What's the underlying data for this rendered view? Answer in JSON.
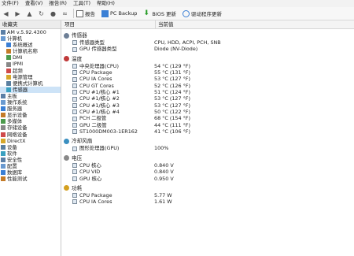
{
  "menu": [
    "文件(F)",
    "查看(V)",
    "报告(R)",
    "工具(T)",
    "帮助(H)"
  ],
  "toolbar": {
    "report_label": "报告",
    "pcbackup_label": "PC Backup",
    "bios_label": "BIOS 更新",
    "driver_label": "驱动程序更新"
  },
  "sidebar": {
    "header": "收藏夹",
    "items": [
      {
        "label": "AM v.5.92.4300",
        "indent": 0
      },
      {
        "label": "计算机",
        "indent": 0
      },
      {
        "label": "系统概述",
        "indent": 1
      },
      {
        "label": "计算机名称",
        "indent": 1
      },
      {
        "label": "DMI",
        "indent": 1
      },
      {
        "label": "IPMI",
        "indent": 1
      },
      {
        "label": "超频",
        "indent": 1
      },
      {
        "label": "电源管理",
        "indent": 1
      },
      {
        "label": "便携式计算机",
        "indent": 1
      },
      {
        "label": "传感器",
        "indent": 1,
        "selected": true
      },
      {
        "label": "主板",
        "indent": 0
      },
      {
        "label": "操作系统",
        "indent": 0
      },
      {
        "label": "服务器",
        "indent": 0
      },
      {
        "label": "显示设备",
        "indent": 0
      },
      {
        "label": "多媒体",
        "indent": 0
      },
      {
        "label": "存储设备",
        "indent": 0
      },
      {
        "label": "网络设备",
        "indent": 0
      },
      {
        "label": "DirectX",
        "indent": 0
      },
      {
        "label": "设备",
        "indent": 0
      },
      {
        "label": "软件",
        "indent": 0
      },
      {
        "label": "安全性",
        "indent": 0
      },
      {
        "label": "配置",
        "indent": 0
      },
      {
        "label": "数据库",
        "indent": 0
      },
      {
        "label": "性能测试",
        "indent": 0
      }
    ]
  },
  "columns": {
    "item": "项目",
    "value": "当前值"
  },
  "sections": [
    {
      "title": "传感器",
      "icon": "sensor-icon",
      "rows": [
        {
          "label": "传感器类型",
          "value": "CPU, HDD, ACPI, PCH, SNB"
        },
        {
          "label": "GPU 传感器类型",
          "value": "Diode (NV-Diode)"
        }
      ]
    },
    {
      "title": "温度",
      "icon": "temperature-icon",
      "rows": [
        {
          "label": "中央处理器(CPU)",
          "value": "54 °C  (129 °F)"
        },
        {
          "label": "CPU Package",
          "value": "55 °C  (131 °F)"
        },
        {
          "label": "CPU IA Cores",
          "value": "53 °C  (127 °F)"
        },
        {
          "label": "CPU GT Cores",
          "value": "52 °C  (126 °F)"
        },
        {
          "label": "CPU #1/核心 #1",
          "value": "51 °C  (124 °F)"
        },
        {
          "label": "CPU #1/核心 #2",
          "value": "53 °C  (127 °F)"
        },
        {
          "label": "CPU #1/核心 #3",
          "value": "53 °C  (127 °F)"
        },
        {
          "label": "CPU #1/核心 #4",
          "value": "50 °C  (122 °F)"
        },
        {
          "label": "PCH 二极管",
          "value": "68 °C  (154 °F)"
        },
        {
          "label": "GPU 二极管",
          "value": "44 °C  (111 °F)"
        },
        {
          "label": "ST1000DM003-1ER162",
          "value": "41 °C  (106 °F)"
        }
      ]
    },
    {
      "title": "冷却风扇",
      "icon": "fan-icon",
      "rows": [
        {
          "label": "图形处理器(GPU)",
          "value": "100%"
        }
      ]
    },
    {
      "title": "电压",
      "icon": "voltage-icon",
      "rows": [
        {
          "label": "CPU 核心",
          "value": "0.840 V"
        },
        {
          "label": "CPU VID",
          "value": "0.840 V"
        },
        {
          "label": "GPU 核心",
          "value": "0.950 V"
        }
      ]
    },
    {
      "title": "功耗",
      "icon": "power-icon",
      "rows": [
        {
          "label": "CPU Package",
          "value": "5.77 W"
        },
        {
          "label": "CPU IA Cores",
          "value": "1.61 W"
        }
      ]
    }
  ],
  "colors": {
    "selection": "#cde3f7",
    "accent": "#2a6ebd"
  }
}
